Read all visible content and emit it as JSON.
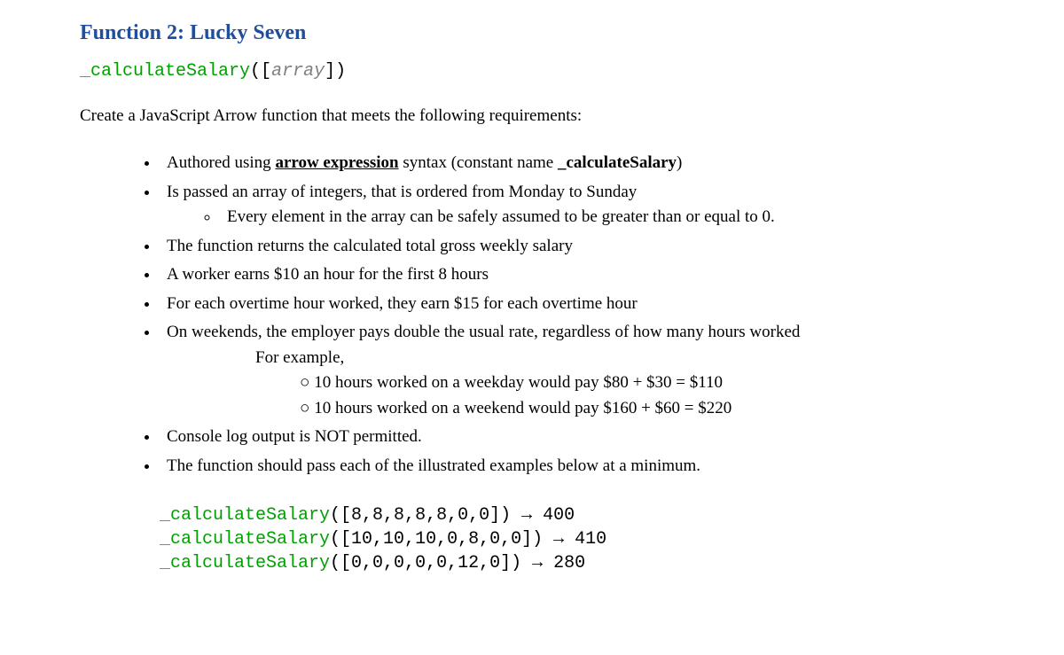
{
  "title": "Function 2: Lucky Seven",
  "signature": {
    "underscore": "_",
    "fn": "calculateSalary",
    "open": "([",
    "args": "array",
    "close": "])"
  },
  "intro": "Create a JavaScript Arrow function that meets the following requirements:",
  "bullets": {
    "b1_pre": "Authored using ",
    "b1_underline": "arrow expression",
    "b1_mid": " syntax (constant name  ",
    "b1_bold": "_calculateSalary",
    "b1_post": ")",
    "b2": "Is passed an array of integers, that is ordered from Monday to Sunday",
    "b2_sub": "Every element in the array can be safely assumed to be greater than or equal to 0.",
    "b3": "The function returns the calculated total gross weekly salary",
    "b4": "A worker earns $10 an hour for the first 8 hours",
    "b5": "For each overtime hour worked, they earn $15 for each overtime hour",
    "b6": "On weekends, the employer pays double the usual rate, regardless of how many hours worked",
    "b6_sub_plain": "For example,",
    "b6_ex1": "10 hours worked on a weekday would pay $80 + $30 = $110",
    "b6_ex2": "10 hours worked on a weekend would pay $160 + $60 = $220",
    "b7": "Console log output is NOT permitted.",
    "b8": "The function should pass each of the illustrated examples below at a minimum."
  },
  "examples": {
    "underscore": "_",
    "fn": "calculateSalary",
    "arrow": " → ",
    "e1_args": "([8,8,8,8,8,0,0])",
    "e1_result": "400",
    "e2_args": "([10,10,10,0,8,0,0])",
    "e2_result": "410",
    "e3_args": "([0,0,0,0,0,12,0])",
    "e3_result": "280"
  }
}
